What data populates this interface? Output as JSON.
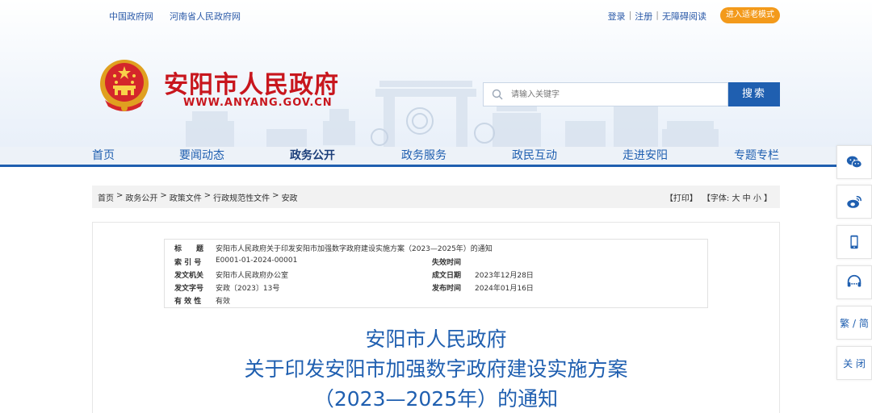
{
  "top_links": [
    "中国政府网",
    "河南省人民政府网"
  ],
  "user_links": {
    "login": "登录",
    "register": "注册",
    "accessible": "无障碍阅读"
  },
  "elder_mode": "进入适老模式",
  "site": {
    "name": "安阳市人民政府",
    "url": "WWW.ANYANG.GOV.CN"
  },
  "search": {
    "placeholder": "请输入关键字",
    "button": "搜索"
  },
  "nav": [
    "首页",
    "要闻动态",
    "政务公开",
    "政务服务",
    "政民互动",
    "走进安阳",
    "专题专栏"
  ],
  "nav_active": "政务公开",
  "breadcrumb": [
    "首页",
    "政务公开",
    "政策文件",
    "行政规范性文件",
    "安政"
  ],
  "tools": {
    "print": "【打印】",
    "font_prefix": "【字体:",
    "large": "大",
    "medium": "中",
    "small": "小",
    "font_suffix": "】"
  },
  "meta": {
    "title_label": "标　　题",
    "title_value": "安阳市人民政府关于印发安阳市加强数字政府建设实施方案（2023—2025年）的通知",
    "index_label": "索 引 号",
    "index_value": "E0001-01-2024-00001",
    "expire_label": "失效时间",
    "expire_value": "",
    "issuer_label": "发文机关",
    "issuer_value": "安阳市人民政府办公室",
    "created_label": "成文日期",
    "created_value": "2023年12月28日",
    "docno_label": "发文字号",
    "docno_value": "安政〔2023〕13号",
    "published_label": "发布时间",
    "published_value": "2024年01月16日",
    "valid_label": "有 效 性",
    "valid_value": "有效"
  },
  "doc_title": [
    "安阳市人民政府",
    "关于印发安阳市加强数字政府建设实施方案",
    "（2023—2025年）的通知"
  ],
  "float_bar": {
    "lang": "繁 / 简",
    "close": "关 闭"
  },
  "colors": {
    "brand_red": "#c8161d",
    "brand_blue": "#1f5fb0",
    "elder_orange": "#f39a1b"
  }
}
